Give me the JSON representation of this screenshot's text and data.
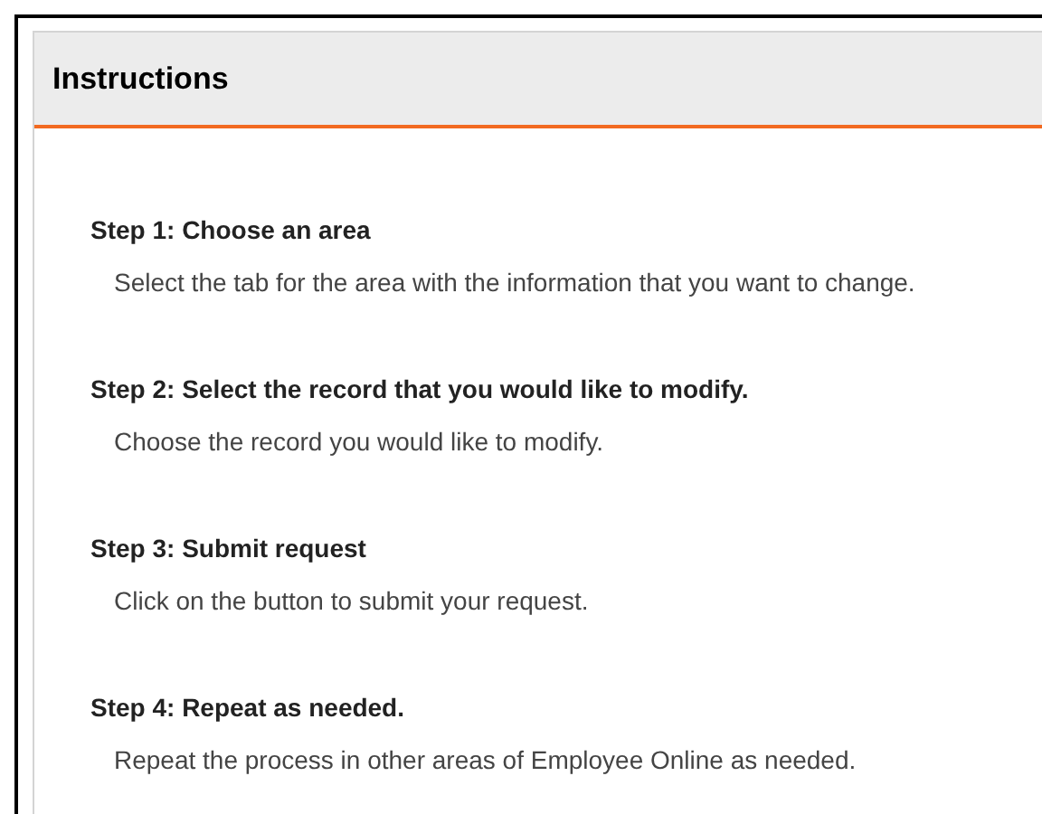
{
  "panel": {
    "title": "Instructions"
  },
  "steps": [
    {
      "title": "Step 1: Choose an area",
      "description": "Select the tab for the area with the information that you want to change."
    },
    {
      "title": "Step 2: Select the record that you would like to modify.",
      "description": "Choose the record you would like to modify."
    },
    {
      "title": "Step 3: Submit request",
      "description": "Click on the button to submit your request."
    },
    {
      "title": "Step 4: Repeat as needed.",
      "description": "Repeat the process in other areas of Employee Online as needed."
    }
  ]
}
